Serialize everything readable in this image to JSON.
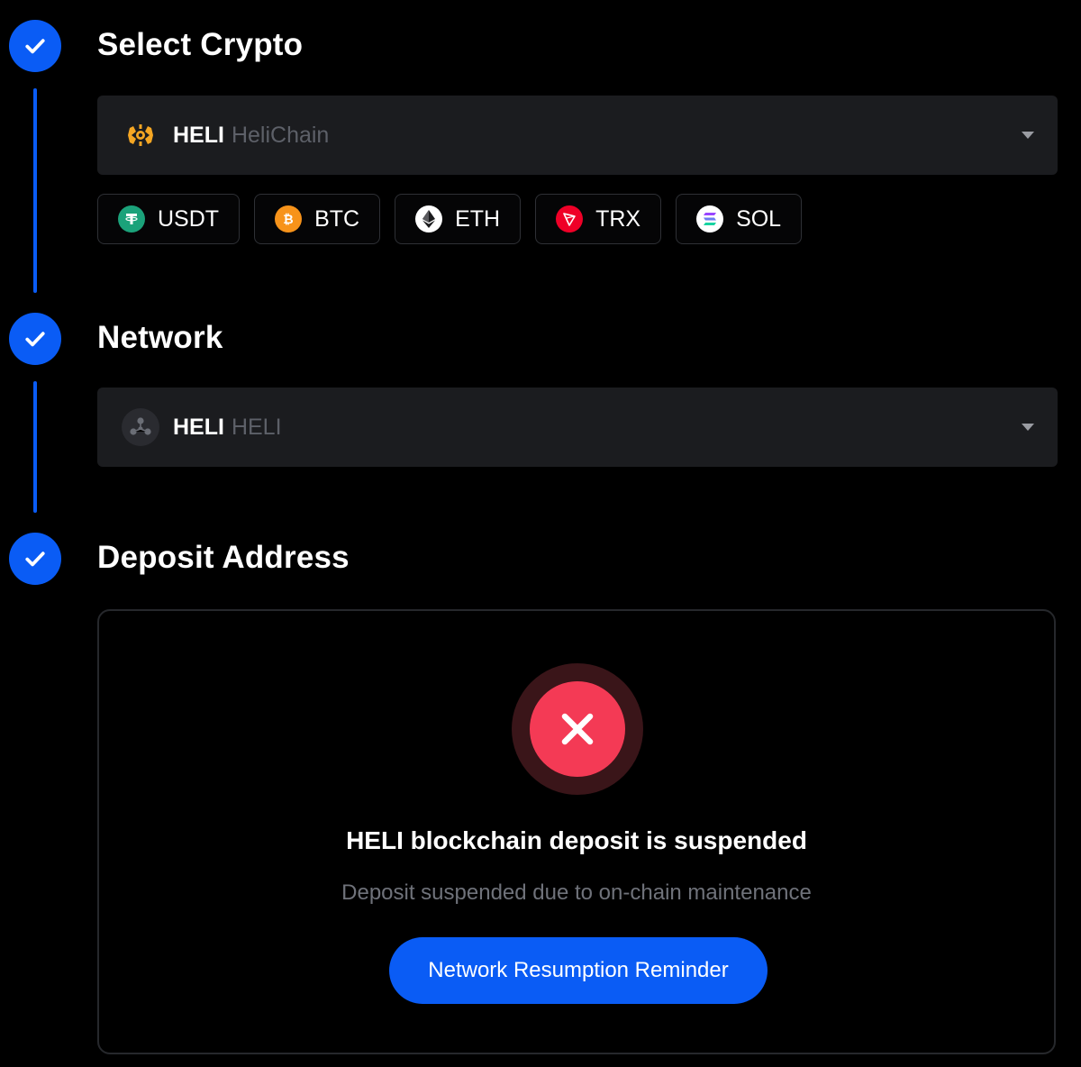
{
  "steps": [
    {
      "title": "Select Crypto"
    },
    {
      "title": "Network"
    },
    {
      "title": "Deposit Address"
    }
  ],
  "crypto_select": {
    "symbol": "HELI",
    "name": "HeliChain",
    "icon": "helichain-logo-icon"
  },
  "quick_coins": [
    {
      "label": "USDT",
      "icon": "tether-icon",
      "color": "#1ba27a"
    },
    {
      "label": "BTC",
      "icon": "bitcoin-icon",
      "color": "#f7931a"
    },
    {
      "label": "ETH",
      "icon": "ethereum-icon",
      "color": "#ffffff"
    },
    {
      "label": "TRX",
      "icon": "tron-icon",
      "color": "#ef0027"
    },
    {
      "label": "SOL",
      "icon": "solana-icon",
      "color": "#ffffff"
    }
  ],
  "network_select": {
    "symbol": "HELI",
    "name": "HELI",
    "icon": "network-nodes-icon"
  },
  "deposit": {
    "status_title": "HELI blockchain deposit is suspended",
    "status_subtitle": "Deposit suspended due to on-chain maintenance",
    "reminder_button": "Network Resumption Reminder",
    "status_icon": "error-x-icon"
  },
  "colors": {
    "accent": "#0a5cf5",
    "error": "#f43a55",
    "background": "#000000",
    "field": "#1b1c1f"
  }
}
